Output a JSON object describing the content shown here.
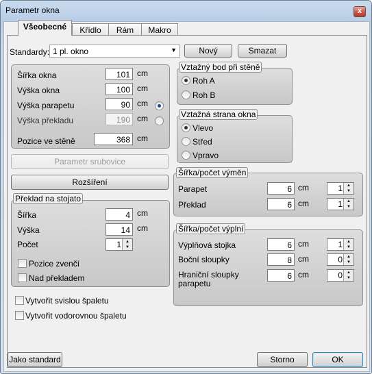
{
  "window": {
    "title": "Parametr okna",
    "close_glyph": "x"
  },
  "tabs": [
    "Všeobecné",
    "Křídlo",
    "Rám",
    "Makro"
  ],
  "standardy": {
    "label": "Standardy:",
    "value": "1 pl. okno",
    "novy": "Nový",
    "smazat": "Smazat"
  },
  "dims": {
    "sirka": {
      "label": "Šířka okna",
      "value": "101",
      "unit": "cm"
    },
    "vyska": {
      "label": "Výška okna",
      "value": "100",
      "unit": "cm"
    },
    "parapet": {
      "label": "Výška parapetu",
      "value": "90",
      "unit": "cm"
    },
    "preklad": {
      "label": "Výška překladu",
      "value": "190",
      "unit": "cm"
    },
    "pozice": {
      "label": "Pozice ve stěně",
      "value": "368",
      "unit": "cm"
    }
  },
  "buttons": {
    "srubovice": "Parametr srubovice",
    "rozsireni": "Rozšíření",
    "jako_standard": "Jako standard",
    "storno": "Storno",
    "ok": "OK"
  },
  "preklad_stojato": {
    "title": "Překlad na stojato",
    "sirka": {
      "label": "Šířka",
      "value": "4",
      "unit": "cm"
    },
    "vyska": {
      "label": "Výška",
      "value": "14",
      "unit": "cm"
    },
    "pocet": {
      "label": "Počet",
      "value": "1"
    },
    "zvenci": "Pozice zvenčí",
    "nad": "Nad překladem"
  },
  "checks": {
    "svisla": "Vytvořit svislou špaletu",
    "vodorovna": "Vytvořit vodorovnou špaletu"
  },
  "bod": {
    "title": "Vztažný bod při stěně",
    "a": "Roh A",
    "b": "Roh B"
  },
  "strana": {
    "title": "Vztažná strana okna",
    "vlevo": "Vlevo",
    "stred": "Střed",
    "vpravo": "Vpravo"
  },
  "vymen": {
    "title": "Šířka/počet výměn",
    "parapet": {
      "label": "Parapet",
      "value": "6",
      "unit": "cm",
      "count": "1"
    },
    "preklad": {
      "label": "Překlad",
      "value": "6",
      "unit": "cm",
      "count": "1"
    }
  },
  "vypln": {
    "title": "Šířka/počet výplní",
    "stojka": {
      "label": "Výplňová stojka",
      "value": "6",
      "unit": "cm",
      "count": "1"
    },
    "bocni": {
      "label": "Boční sloupky",
      "value": "8",
      "unit": "cm",
      "count": "0"
    },
    "hranicni": {
      "label": "Hraniční sloupky parapetu",
      "value": "6",
      "unit": "cm",
      "count": "0"
    }
  }
}
